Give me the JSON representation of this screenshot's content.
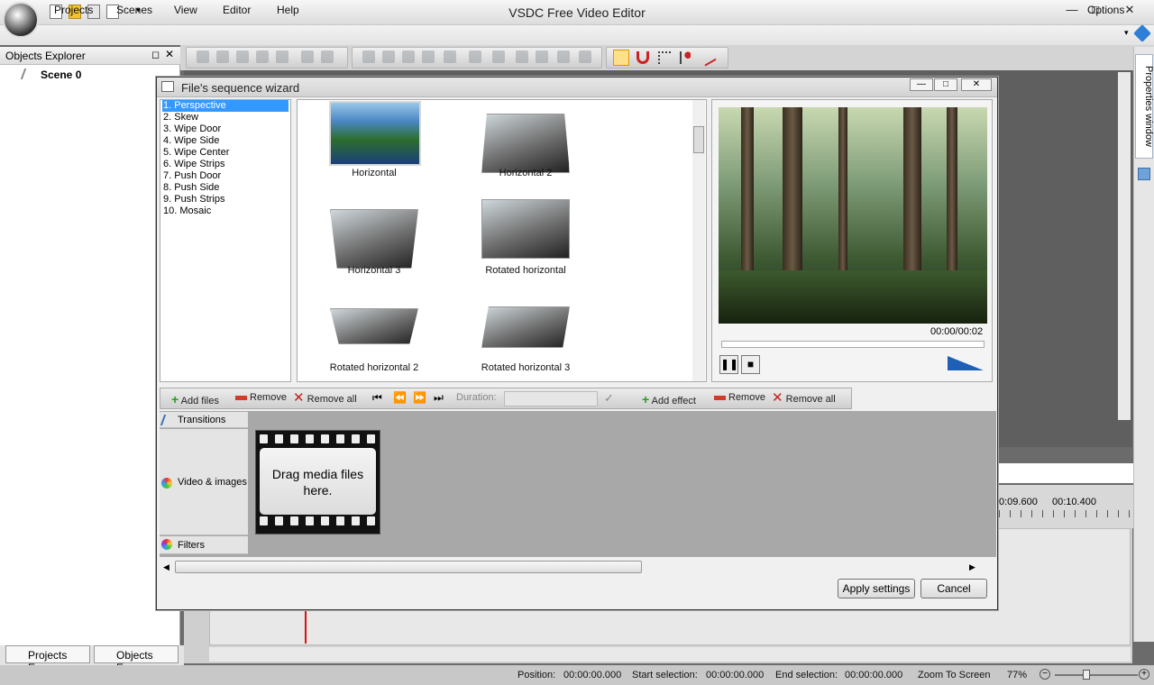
{
  "window": {
    "title": "VSDC Free Video Editor",
    "minimize": "—",
    "restore": "□",
    "close": "✕"
  },
  "menu": {
    "items": [
      "Projects",
      "Scenes",
      "View",
      "Editor",
      "Help"
    ],
    "options": "Options"
  },
  "objects_explorer": {
    "title": "Objects Explorer",
    "tree": [
      "Scene 0"
    ]
  },
  "properties_window": {
    "label": "Properties window"
  },
  "bottom_tabs": [
    "Projects Ex...",
    "Objects Ex..."
  ],
  "status": {
    "position_label": "Position:",
    "position": "00:00:00.000",
    "start_label": "Start selection:",
    "start": "00:00:00.000",
    "end_label": "End selection:",
    "end": "00:00:00.000",
    "zoom_label": "Zoom To Screen",
    "zoom": "77%"
  },
  "timeline": {
    "ticks": [
      "0:09.600",
      "00:10.400"
    ]
  },
  "dialog": {
    "title": "File's sequence wizard",
    "effects": [
      "1. Perspective",
      "2. Skew",
      "3. Wipe Door",
      "4. Wipe Side",
      "5. Wipe Center",
      "6. Wipe Strips",
      "7. Push Door",
      "8. Push Side",
      "9. Push Strips",
      "10. Mosaic"
    ],
    "selected_effect": "1. Perspective",
    "thumbnails": [
      "Horizontal",
      "Horizontal 2",
      "Horizontal 3",
      "Rotated horizontal",
      "Rotated horizontal 2",
      "Rotated horizontal 3"
    ],
    "preview_time": "00:00/00:02",
    "toolbar": {
      "add_files": "Add files",
      "remove": "Remove",
      "remove_all": "Remove all",
      "duration": "Duration:",
      "add_effect": "Add effect",
      "remove2": "Remove",
      "remove_all2": "Remove all"
    },
    "tracks": [
      "Transitions",
      "Video & images",
      "Filters"
    ],
    "drop_hint": "Drag media files here.",
    "apply": "Apply settings",
    "cancel": "Cancel"
  }
}
